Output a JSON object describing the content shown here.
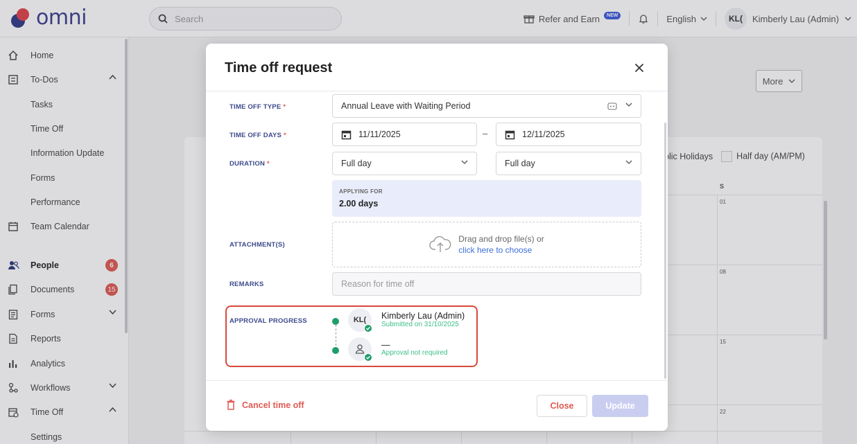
{
  "app": {
    "logo_text": "omni"
  },
  "topbar": {
    "search_placeholder": "Search",
    "refer_label": "Refer and Earn",
    "new_badge": "NEW",
    "language": "English",
    "user_initials": "KL(",
    "user_name": "Kimberly Lau (Admin)"
  },
  "sidebar": {
    "items": [
      {
        "label": "Home",
        "icon": "home-icon"
      },
      {
        "label": "To-Dos",
        "icon": "list-icon"
      },
      {
        "label": "Tasks"
      },
      {
        "label": "Time Off"
      },
      {
        "label": "Information Update"
      },
      {
        "label": "Forms"
      },
      {
        "label": "Performance"
      },
      {
        "label": "Team Calendar",
        "icon": "calendar-icon"
      },
      {
        "label": "People",
        "icon": "people-icon",
        "badge": "6"
      },
      {
        "label": "Documents",
        "icon": "documents-icon",
        "badge": "15"
      },
      {
        "label": "Forms",
        "icon": "forms-icon"
      },
      {
        "label": "Reports",
        "icon": "reports-icon"
      },
      {
        "label": "Analytics",
        "icon": "analytics-icon"
      },
      {
        "label": "Workflows",
        "icon": "workflows-icon"
      },
      {
        "label": "Time Off",
        "icon": "time-off-icon"
      },
      {
        "label": "Settings"
      }
    ]
  },
  "background": {
    "more_label": "More",
    "legend_public_holidays": "blic Holidays",
    "legend_half_day": "Half day (AM/PM)",
    "day_header": "S",
    "day_numbers": [
      "01",
      "08",
      "15",
      "22"
    ]
  },
  "modal": {
    "title": "Time off request",
    "time_off_type_label": "TIME OFF TYPE",
    "time_off_type_value": "Annual Leave with Waiting Period",
    "time_off_days_label": "TIME OFF DAYS",
    "start_date": "11/11/2025",
    "date_separator": "–",
    "end_date": "12/11/2025",
    "duration_label": "DURATION",
    "duration_start": "Full day",
    "duration_end": "Full day",
    "applying_for_label": "APPLYING FOR",
    "applying_for_value": "2.00 days",
    "attachments_label": "ATTACHMENT(S)",
    "dropzone_text": "Drag and drop file(s) or",
    "dropzone_link": "click here to choose",
    "remarks_label": "REMARKS",
    "remarks_placeholder": "Reason for time off",
    "approval_label": "APPROVAL PROGRESS",
    "approvers": [
      {
        "initials": "KL(",
        "name": "Kimberly Lau (Admin)",
        "status": "Submitted on 31/10/2025"
      },
      {
        "name": "—",
        "status": "Approval not required"
      }
    ],
    "required_mark": "*",
    "cancel_label": "Cancel time off",
    "close_label": "Close",
    "update_label": "Update"
  },
  "colors": {
    "accent": "#3c4a8c",
    "danger": "#e05a52",
    "success": "#1f9d6b"
  }
}
